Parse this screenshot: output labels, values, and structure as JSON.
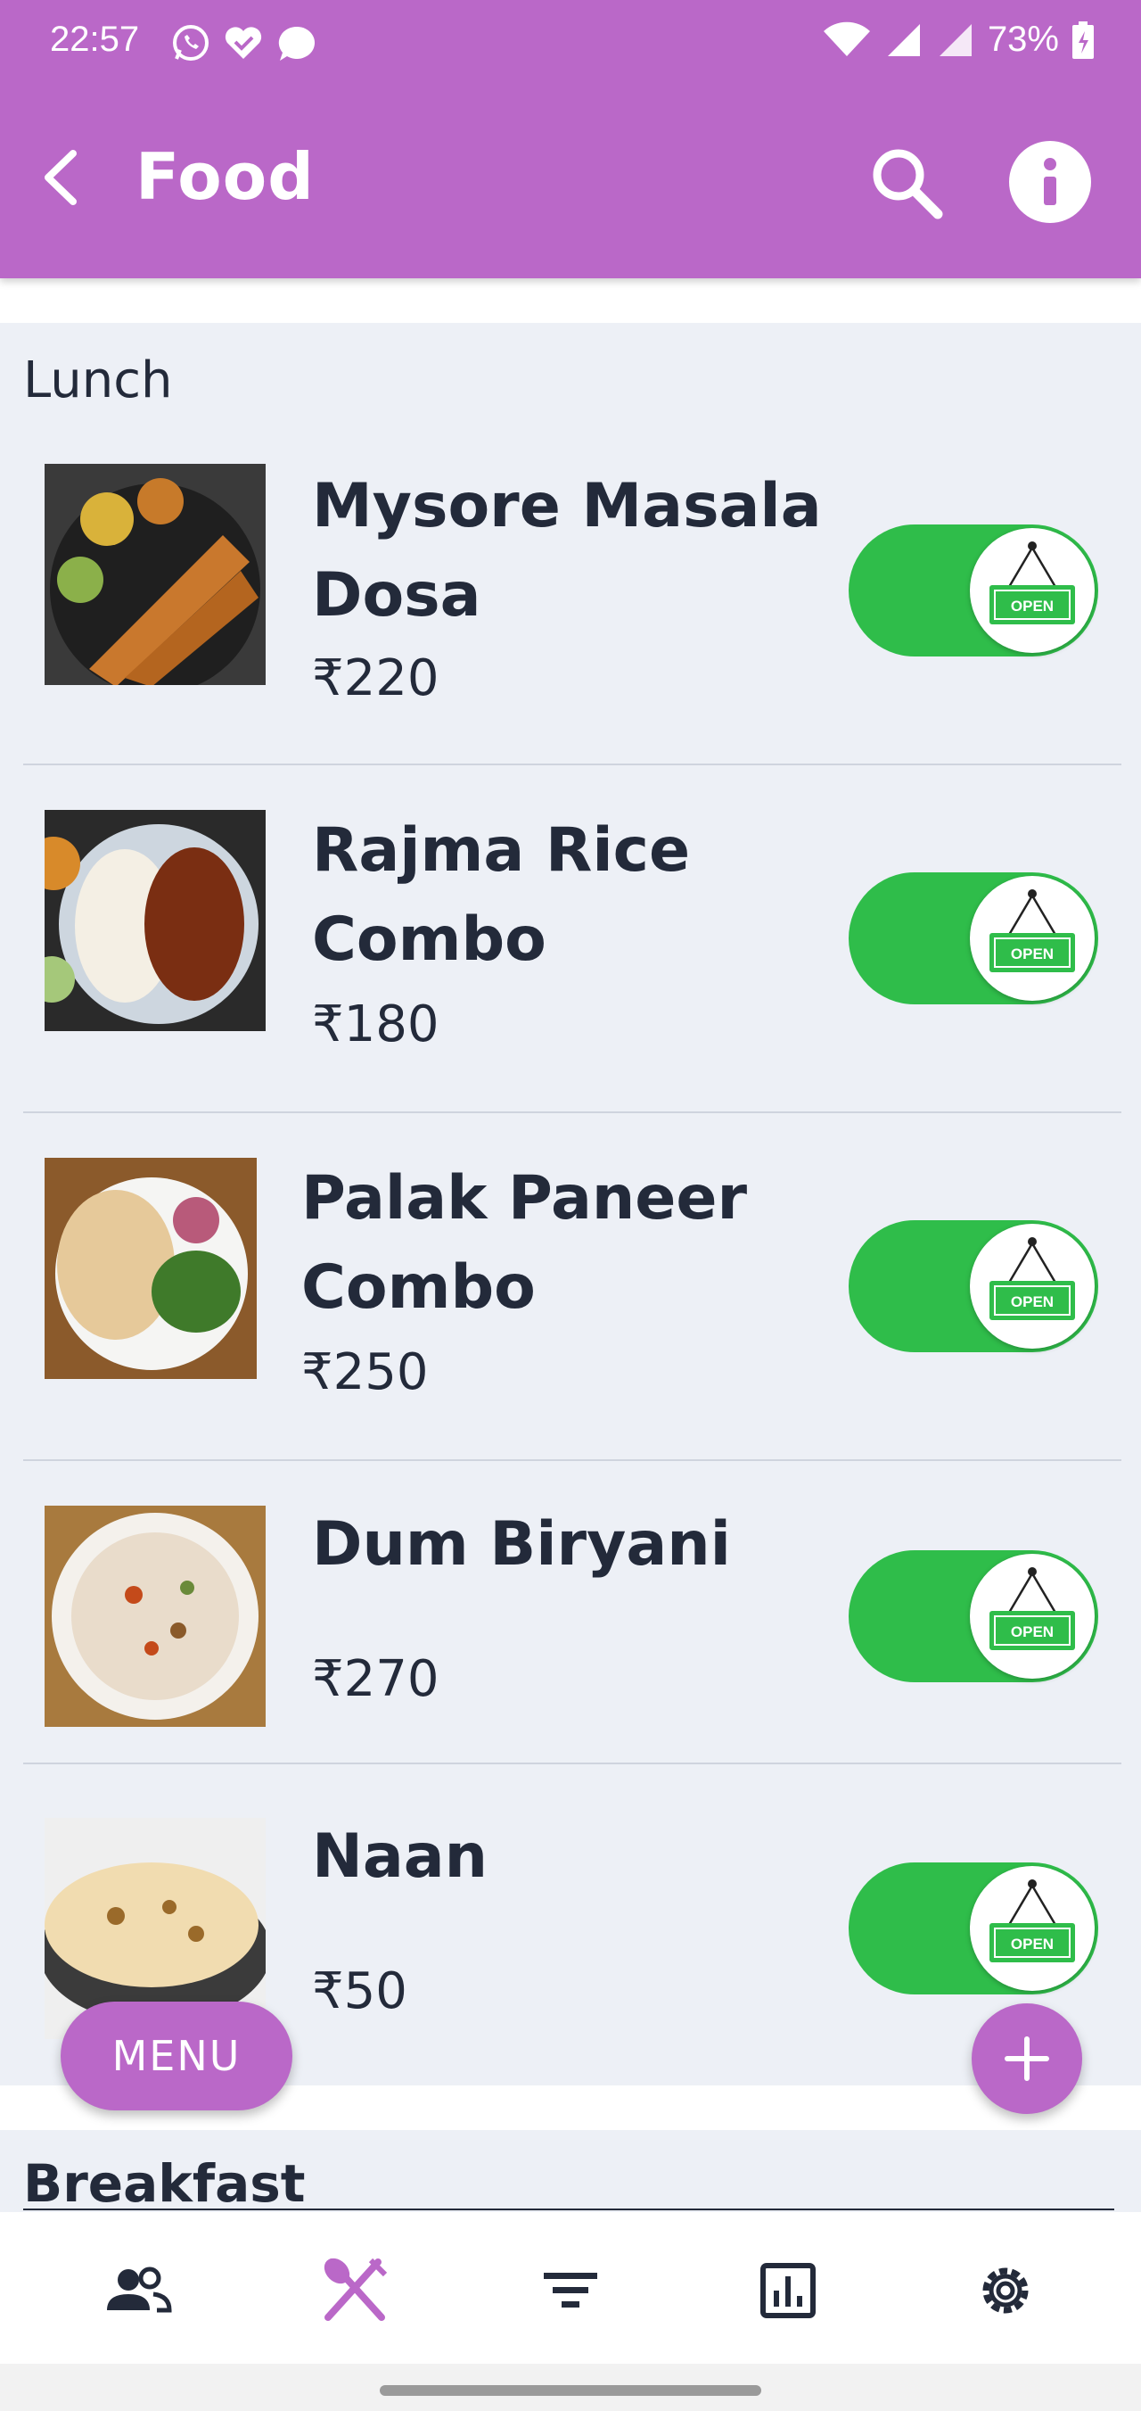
{
  "status_bar": {
    "time": "22:57",
    "battery": "73%"
  },
  "app_bar": {
    "title": "Food"
  },
  "colors": {
    "accent": "#ba68c8",
    "toggle_on": "#2fbd4a",
    "sign_green": "#2fbd4a",
    "background": "#edf0f6",
    "text": "#232a3a"
  },
  "sections": {
    "lunch": {
      "title": "Lunch",
      "items": [
        {
          "name": "Mysore Masala Dosa",
          "price": "₹220",
          "status": "OPEN",
          "available": true
        },
        {
          "name": "Rajma Rice Combo",
          "price": "₹180",
          "status": "OPEN",
          "available": true
        },
        {
          "name": "Palak Paneer Combo",
          "price": "₹250",
          "status": "OPEN",
          "available": true
        },
        {
          "name": "Dum Biryani",
          "price": "₹270",
          "status": "OPEN",
          "available": true
        },
        {
          "name": "Naan",
          "price": "₹50",
          "status": "OPEN",
          "available": true
        }
      ]
    },
    "breakfast": {
      "title": "Breakfast"
    }
  },
  "floating": {
    "menu_label": "MENU",
    "add_icon": "plus-icon"
  },
  "bottom_nav": [
    {
      "icon": "people-icon",
      "active": false
    },
    {
      "icon": "cutlery-icon",
      "active": true
    },
    {
      "icon": "filter-icon",
      "active": false
    },
    {
      "icon": "bar-chart-icon",
      "active": false
    },
    {
      "icon": "gear-icon",
      "active": false
    }
  ]
}
